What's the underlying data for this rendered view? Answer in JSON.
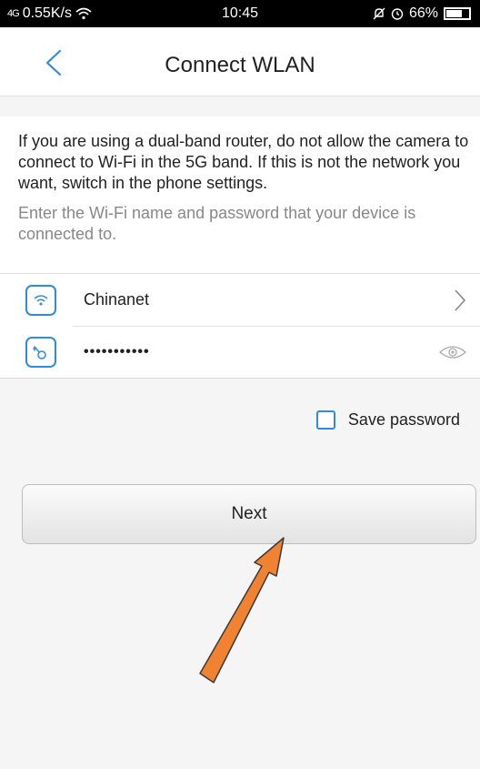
{
  "status_bar": {
    "signal": "4G",
    "speed": "0.55K/s",
    "time": "10:45",
    "battery": "66%"
  },
  "header": {
    "title": "Connect WLAN"
  },
  "content": {
    "warning": "If you are using a dual-band router, do not allow the camera to connect to Wi-Fi in the 5G band. If this is not the network you want, switch in the phone settings.",
    "hint": "Enter the Wi-Fi name and password that your device is connected to."
  },
  "wifi": {
    "ssid": "Chinanet"
  },
  "password": {
    "masked": "•••••••••••"
  },
  "save_password": {
    "label": "Save password",
    "checked": false
  },
  "next_button": {
    "label": "Next"
  },
  "colors": {
    "accent": "#2f8be0",
    "annotation_arrow": "#f08232"
  }
}
